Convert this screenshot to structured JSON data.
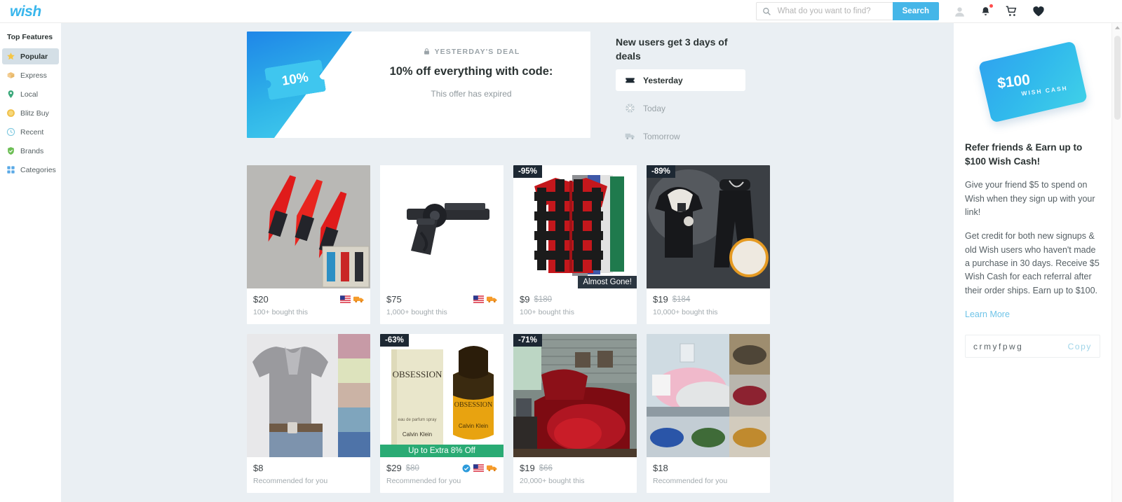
{
  "header": {
    "logo": "wish",
    "search": {
      "placeholder": "What do you want to find?",
      "value": ""
    },
    "search_button": "Search",
    "icons": [
      "account-icon",
      "notifications-bell-icon",
      "shopping-cart-icon",
      "wishlist-heart-icon"
    ],
    "accent_color": "#45b6e8"
  },
  "sidebar": {
    "title": "Top Features",
    "items": [
      {
        "label": "Popular",
        "icon": "star-icon",
        "active": true
      },
      {
        "label": "Express",
        "icon": "package-icon",
        "active": false
      },
      {
        "label": "Local",
        "icon": "location-pin-icon",
        "active": false
      },
      {
        "label": "Blitz Buy",
        "icon": "coin-icon",
        "active": false
      },
      {
        "label": "Recent",
        "icon": "clock-icon",
        "active": false
      },
      {
        "label": "Brands",
        "icon": "shield-check-icon",
        "active": false
      },
      {
        "label": "Categories",
        "icon": "grid-icon",
        "active": false
      }
    ]
  },
  "deal": {
    "coupon_percent": "10%",
    "kicker": "YESTERDAY'S DEAL",
    "headline": "10% off everything with code:",
    "status": "This offer has expired"
  },
  "days": {
    "title": "New users get 3 days of deals",
    "options": [
      {
        "label": "Yesterday",
        "icon": "ticket-icon",
        "active": true
      },
      {
        "label": "Today",
        "icon": "gift-icon",
        "active": false
      },
      {
        "label": "Tomorrow",
        "icon": "truck-icon",
        "active": false
      }
    ]
  },
  "products": [
    {
      "name": "throwing-knives",
      "price": "$20",
      "old_price": "",
      "discount": "",
      "sold": "100+ bought this",
      "overlay": "",
      "green_banner": "",
      "flag": true,
      "truck": true,
      "verified": false,
      "has_variant_strip": true
    },
    {
      "name": "revolver",
      "price": "$75",
      "old_price": "",
      "discount": "",
      "sold": "1,000+ bought this",
      "overlay": "",
      "green_banner": "",
      "flag": true,
      "truck": true,
      "verified": false,
      "has_variant_strip": false
    },
    {
      "name": "plaid-shirt",
      "price": "$9",
      "old_price": "$180",
      "discount": "-95%",
      "sold": "100+ bought this",
      "overlay": "Almost Gone!",
      "green_banner": "",
      "flag": false,
      "truck": false,
      "verified": false,
      "has_variant_strip": false
    },
    {
      "name": "hoodie-tracksuit",
      "price": "$19",
      "old_price": "$184",
      "discount": "-89%",
      "sold": "10,000+ bought this",
      "overlay": "",
      "green_banner": "",
      "flag": false,
      "truck": false,
      "verified": false,
      "has_variant_strip": false
    },
    {
      "name": "henley-shirt",
      "price": "$8",
      "old_price": "",
      "discount": "",
      "sold": "Recommended for you",
      "overlay": "",
      "green_banner": "",
      "flag": false,
      "truck": false,
      "verified": false,
      "has_variant_strip": true
    },
    {
      "name": "obsession-perfume",
      "price": "$29",
      "old_price": "$80",
      "discount": "-63%",
      "sold": "Recommended for you",
      "overlay": "",
      "green_banner": "Up to Extra 8% Off",
      "flag": true,
      "truck": true,
      "verified": true,
      "has_variant_strip": false
    },
    {
      "name": "red-bedding-set",
      "price": "$19",
      "old_price": "$66",
      "discount": "-71%",
      "sold": "20,000+ bought this",
      "overlay": "",
      "green_banner": "",
      "flag": false,
      "truck": false,
      "verified": false,
      "has_variant_strip": false
    },
    {
      "name": "pink-bedding-set",
      "price": "$18",
      "old_price": "",
      "discount": "",
      "sold": "Recommended for you",
      "overlay": "",
      "green_banner": "",
      "flag": false,
      "truck": false,
      "verified": false,
      "has_variant_strip": true
    }
  ],
  "referral": {
    "card_amount": "$100",
    "card_label": "WISH CASH",
    "title": "Refer friends & Earn up to $100 Wish Cash!",
    "para1": "Give your friend $5 to spend on Wish when they sign up with your link!",
    "para2": "Get credit for both new signups & old Wish users who haven't made a purchase in 30 days. Receive $5 Wish Cash for each referral after their order ships. Earn up to $100.",
    "learn_more": "Learn More",
    "code": "crmyfpwg",
    "copy_label": "Copy"
  }
}
